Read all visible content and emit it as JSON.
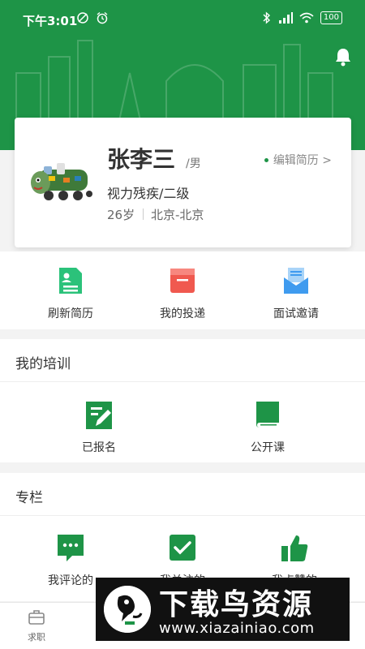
{
  "status_bar": {
    "time": "下午3:01",
    "battery": "100",
    "left_icons": [
      "no-disturb-icon",
      "alarm-icon"
    ],
    "right_icons": [
      "bluetooth-icon",
      "signal-icon",
      "wifi-icon"
    ]
  },
  "header": {
    "color": "#1e9447",
    "bell_icon": "bell-icon"
  },
  "profile": {
    "name": "张李三",
    "gender": "/男",
    "edit_label": "编辑简历 >",
    "disability": "视力残疾/二级",
    "age": "26岁",
    "location": "北京-北京"
  },
  "quick_actions": [
    {
      "label": "刷新简历",
      "icon": "resume-icon",
      "color": "#2bc27a"
    },
    {
      "label": "我的投递",
      "icon": "box-icon",
      "color": "#f0594f"
    },
    {
      "label": "面试邀请",
      "icon": "envelope-icon",
      "color": "#3f9bef"
    }
  ],
  "training": {
    "title": "我的培训",
    "items": [
      {
        "label": "已报名",
        "icon": "edit-form-icon"
      },
      {
        "label": "公开课",
        "icon": "book-icon"
      }
    ]
  },
  "column": {
    "title": "专栏",
    "items": [
      {
        "label": "我评论的",
        "icon": "comment-icon"
      },
      {
        "label": "我关注的",
        "icon": "checkbox-icon"
      },
      {
        "label": "我点赞的",
        "icon": "thumbs-up-icon"
      }
    ]
  },
  "tabbar": {
    "items": [
      {
        "label": "求职",
        "icon": "briefcase-icon"
      }
    ]
  },
  "watermark": {
    "title": "下载鸟资源",
    "url": "www.xiazainiao.com"
  }
}
